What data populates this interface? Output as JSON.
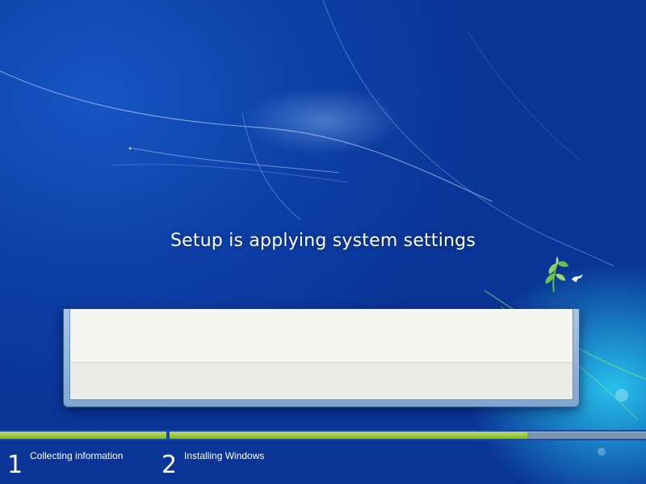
{
  "status": {
    "message": "Setup is applying system settings"
  },
  "steps": [
    {
      "number": "1",
      "label": "Collecting information",
      "progress": 1.0
    },
    {
      "number": "2",
      "label": "Installing Windows",
      "progress": 0.75
    }
  ],
  "colors": {
    "background": "#0b3a9e",
    "progress_fill": "#8fc43a",
    "progress_remaining": "#7c93ae",
    "panel_frame": "#9bbbe0",
    "panel_body": "#f4f4f4"
  },
  "icons": {
    "logo": "windows-flower-logo-icon"
  }
}
